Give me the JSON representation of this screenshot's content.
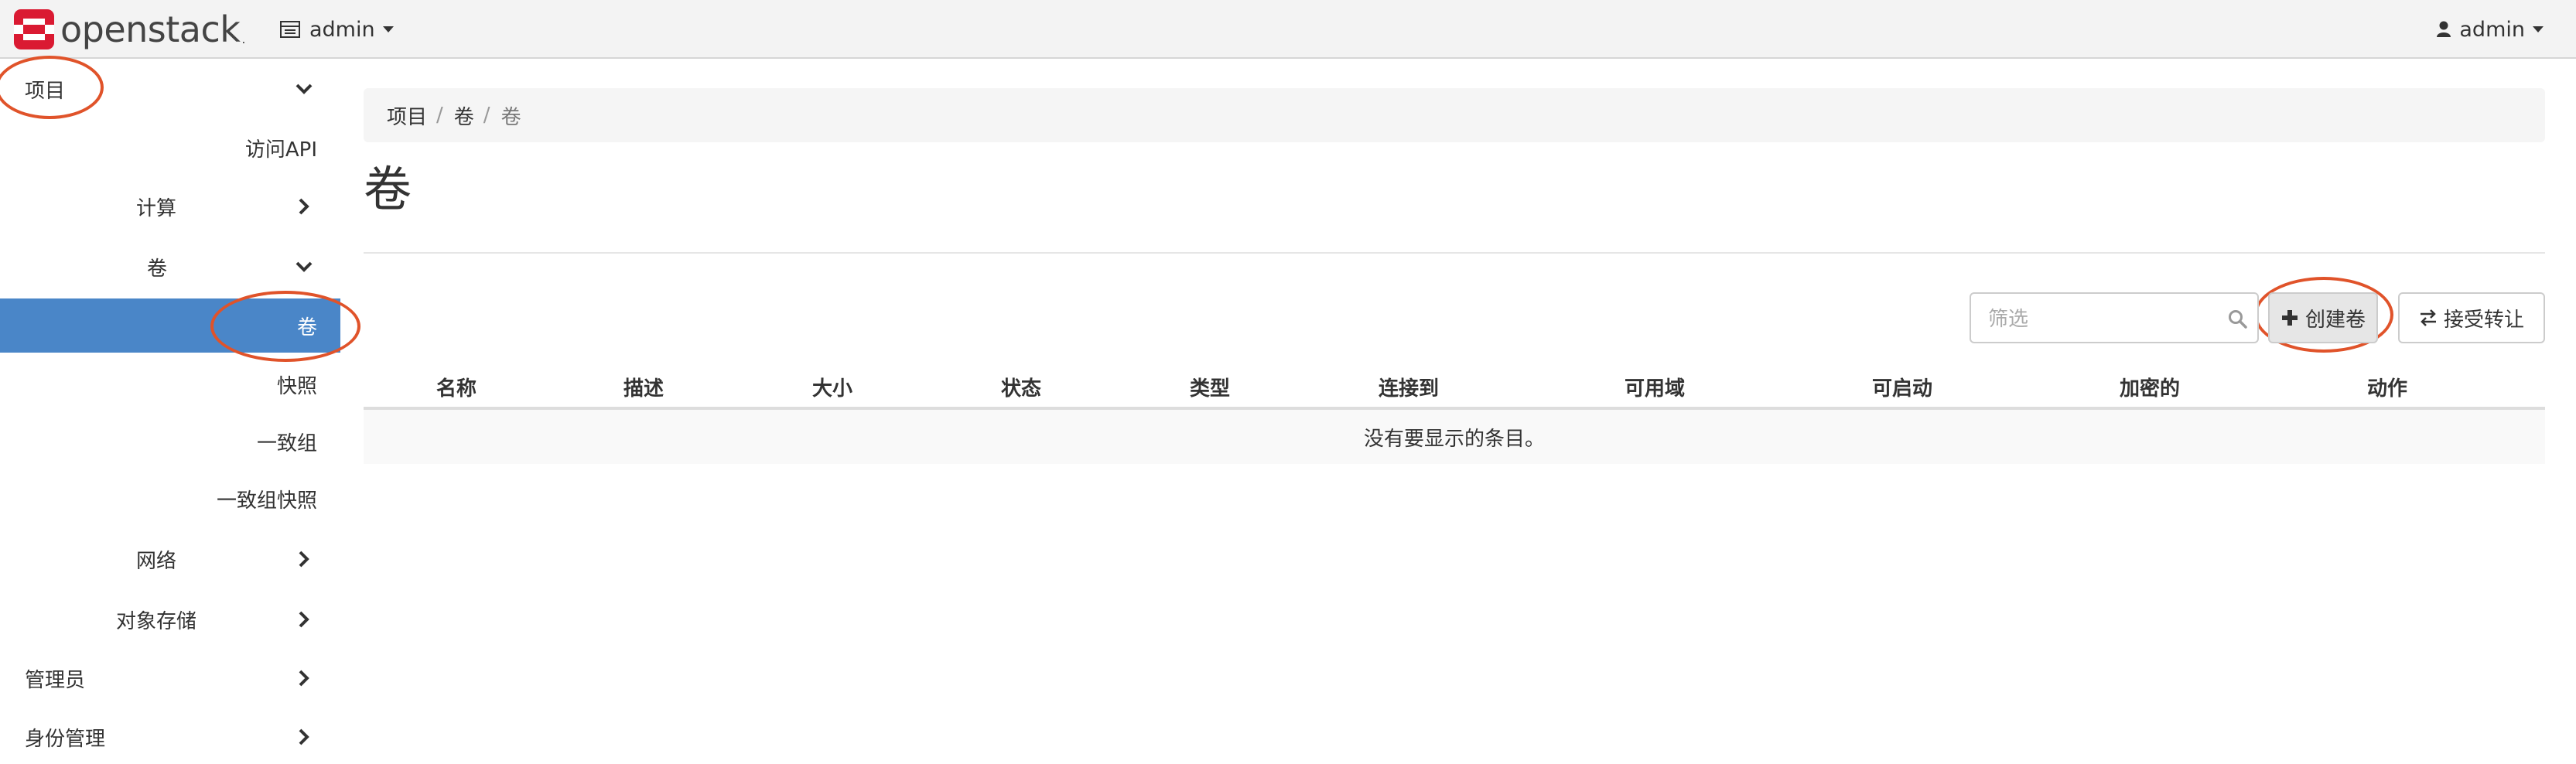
{
  "navbar": {
    "logo_text": "openstack",
    "logo_dot": ".",
    "project_label": "admin",
    "user_label": "admin"
  },
  "sidebar": {
    "items": [
      {
        "label": "项目",
        "icon": "chevron-down-icon"
      },
      {
        "label": "访问API"
      },
      {
        "label": "计算",
        "icon": "chevron-right-icon"
      },
      {
        "label": "卷",
        "icon": "chevron-down-icon"
      },
      {
        "label": "卷",
        "active": true
      },
      {
        "label": "快照"
      },
      {
        "label": "一致组"
      },
      {
        "label": "一致组快照"
      },
      {
        "label": "网络",
        "icon": "chevron-right-icon"
      },
      {
        "label": "对象存储",
        "icon": "chevron-right-icon"
      },
      {
        "label": "管理员",
        "icon": "chevron-right-icon"
      },
      {
        "label": "身份管理",
        "icon": "chevron-right-icon"
      }
    ]
  },
  "breadcrumb": [
    "项目",
    "卷",
    "卷"
  ],
  "page": {
    "title": "卷"
  },
  "toolbar": {
    "filter_placeholder": "筛选",
    "create_label": "创建卷",
    "accept_label": "接受转让"
  },
  "table": {
    "columns": [
      "名称",
      "描述",
      "大小",
      "状态",
      "类型",
      "连接到",
      "可用域",
      "可启动",
      "加密的",
      "动作"
    ],
    "empty_message": "没有要显示的条目。"
  },
  "colors": {
    "accent": "#4a86c8",
    "annotation": "#e0532a",
    "logo_red": "#da1a32"
  }
}
